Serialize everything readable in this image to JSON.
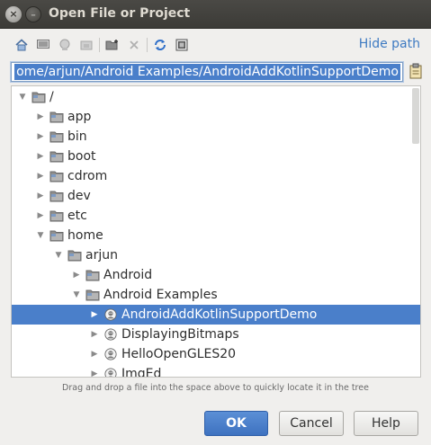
{
  "window": {
    "title": "Open File or Project",
    "close_glyph": "×",
    "minimize_glyph": "–"
  },
  "toolbar": {
    "icons": [
      "home-icon",
      "desktop-icon",
      "project-icon",
      "module-icon",
      "new-folder-icon",
      "delete-icon",
      "refresh-icon",
      "show-hidden-icon"
    ],
    "hide_path_label": "Hide path"
  },
  "path": {
    "value": "ome/arjun/Android Examples/AndroidAddKotlinSupportDemo"
  },
  "tree": {
    "rows": [
      {
        "label": "/",
        "depth": 0,
        "expanded": true,
        "kind": "folder"
      },
      {
        "label": "app",
        "depth": 1,
        "expanded": false,
        "kind": "folder"
      },
      {
        "label": "bin",
        "depth": 1,
        "expanded": false,
        "kind": "folder"
      },
      {
        "label": "boot",
        "depth": 1,
        "expanded": false,
        "kind": "folder"
      },
      {
        "label": "cdrom",
        "depth": 1,
        "expanded": false,
        "kind": "folder"
      },
      {
        "label": "dev",
        "depth": 1,
        "expanded": false,
        "kind": "folder"
      },
      {
        "label": "etc",
        "depth": 1,
        "expanded": false,
        "kind": "folder"
      },
      {
        "label": "home",
        "depth": 1,
        "expanded": true,
        "kind": "folder"
      },
      {
        "label": "arjun",
        "depth": 2,
        "expanded": true,
        "kind": "folder"
      },
      {
        "label": "Android",
        "depth": 3,
        "expanded": false,
        "kind": "folder"
      },
      {
        "label": "Android Examples",
        "depth": 3,
        "expanded": true,
        "kind": "folder"
      },
      {
        "label": "AndroidAddKotlinSupportDemo",
        "depth": 4,
        "expanded": false,
        "kind": "project",
        "selected": true
      },
      {
        "label": "DisplayingBitmaps",
        "depth": 4,
        "expanded": false,
        "kind": "project"
      },
      {
        "label": "HelloOpenGLES20",
        "depth": 4,
        "expanded": false,
        "kind": "project"
      },
      {
        "label": "ImgEd",
        "depth": 4,
        "expanded": false,
        "kind": "project"
      }
    ]
  },
  "hint": "Drag and drop a file into the space above to quickly locate it in the tree",
  "buttons": {
    "ok": "OK",
    "cancel": "Cancel",
    "help": "Help"
  },
  "colors": {
    "selection": "#4a7fca",
    "link": "#3f7bc2",
    "titlebar": "#3c3b37"
  }
}
